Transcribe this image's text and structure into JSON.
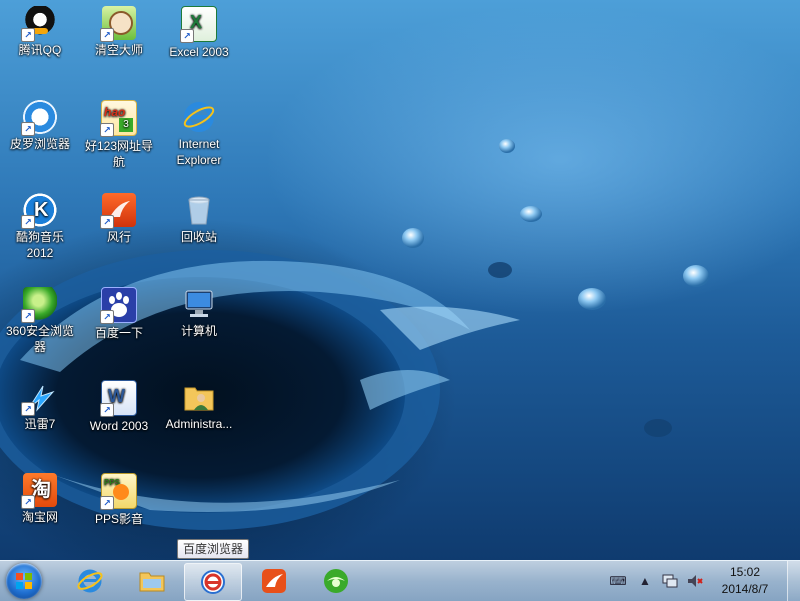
{
  "desktop": {
    "icons": [
      {
        "label": "腾讯QQ",
        "icon": "qq-icon"
      },
      {
        "label": "清空大师",
        "icon": "cleaner-icon"
      },
      {
        "label": "Excel 2003",
        "icon": "excel-icon"
      },
      {
        "label": "皮罗浏览器",
        "icon": "browser-e-icon"
      },
      {
        "label": "好123网址导航",
        "icon": "hao123-icon"
      },
      {
        "label": "Internet Explorer",
        "icon": "ie-icon"
      },
      {
        "label": "酷狗音乐2012",
        "icon": "kugou-icon"
      },
      {
        "label": "风行",
        "icon": "funshion-icon"
      },
      {
        "label": "回收站",
        "icon": "recycle-bin-icon"
      },
      {
        "label": "360安全浏览器",
        "icon": "360-browser-icon"
      },
      {
        "label": "百度一下",
        "icon": "baidu-icon"
      },
      {
        "label": "计算机",
        "icon": "computer-icon"
      },
      {
        "label": "迅雷7",
        "icon": "xunlei-icon"
      },
      {
        "label": "Word 2003",
        "icon": "word-icon"
      },
      {
        "label": "Administra...",
        "icon": "user-folder-icon"
      },
      {
        "label": "淘宝网",
        "icon": "taobao-icon"
      },
      {
        "label": "PPS影音",
        "icon": "pps-icon"
      }
    ]
  },
  "tooltip": {
    "text": "百度浏览器"
  },
  "taskbar": {
    "start_icon": "windows-start-icon",
    "pinned": [
      "ie-icon",
      "explorer-folder-icon",
      "baidu-browser-icon",
      "funshion-icon",
      "360-browser-icon"
    ],
    "tray": [
      "keyboard-icon",
      "show-hidden-icon",
      "network-icon",
      "volume-muted-icon"
    ],
    "clock": {
      "time": "15:02",
      "date": "2014/8/7"
    }
  },
  "colors": {
    "accent": "#1f6fd0",
    "taskbar": "#a5bed7"
  }
}
